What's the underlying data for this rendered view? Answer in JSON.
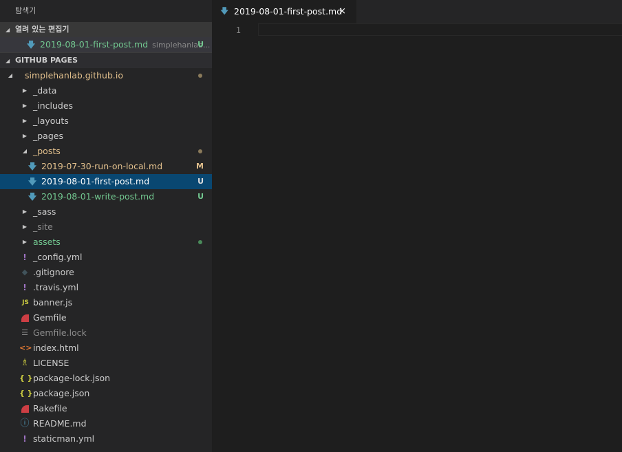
{
  "sidebar": {
    "title": "탐색기",
    "open_editors": {
      "header": "열려 있는 편집기",
      "items": [
        {
          "name": "2019-08-01-first-post.md",
          "description": "simplehanlab...",
          "status": "U"
        }
      ]
    },
    "workspace": {
      "header": "GITHUB PAGES",
      "tree": [
        {
          "label": "simplehanlab.github.io",
          "badge": ""
        },
        {
          "label": "_data"
        },
        {
          "label": "_includes"
        },
        {
          "label": "_layouts"
        },
        {
          "label": "_pages"
        },
        {
          "label": "_posts"
        },
        {
          "label": "2019-07-30-run-on-local.md",
          "badge": "M"
        },
        {
          "label": "2019-08-01-first-post.md",
          "badge": "U"
        },
        {
          "label": "2019-08-01-write-post.md",
          "badge": "U"
        },
        {
          "label": "_sass"
        },
        {
          "label": "_site"
        },
        {
          "label": "assets"
        },
        {
          "label": "_config.yml"
        },
        {
          "label": ".gitignore"
        },
        {
          "label": ".travis.yml"
        },
        {
          "label": "banner.js"
        },
        {
          "label": "Gemfile"
        },
        {
          "label": "Gemfile.lock"
        },
        {
          "label": "index.html"
        },
        {
          "label": "LICENSE"
        },
        {
          "label": "package-lock.json"
        },
        {
          "label": "package.json"
        },
        {
          "label": "Rakefile"
        },
        {
          "label": "README.md"
        },
        {
          "label": "staticman.yml"
        }
      ]
    }
  },
  "editor": {
    "tab": {
      "label": "2019-08-01-first-post.md",
      "close": "×"
    },
    "line_numbers": [
      "1"
    ]
  },
  "icons": {
    "markdown": "#519aba",
    "yaml": "#a074c4",
    "git": "#41535b",
    "js": "#cbcb41",
    "ruby": "#cc3e44",
    "html": "#e37933",
    "license": "#cbcb41",
    "json": "#cbcb41",
    "info": "#519aba",
    "lock": "#8c8c8c"
  },
  "colors": {
    "modified": "#e2c08d",
    "untracked": "#73c991",
    "selection": "#094771"
  }
}
